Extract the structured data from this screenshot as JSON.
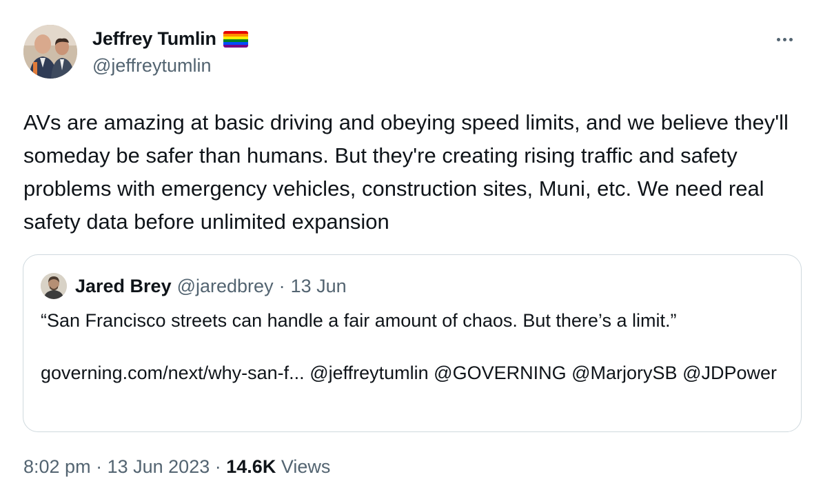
{
  "author": {
    "display_name": "Jeffrey Tumlin",
    "handle": "@jeffreytumlin",
    "badge_icon": "rainbow-flag-icon"
  },
  "tweet": {
    "text": "AVs are amazing at basic driving and obeying speed limits, and we believe they'll someday be safer than humans. But they're creating rising traffic and safety problems with emergency vehicles, construction sites, Muni, etc. We need real safety data before unlimited expansion"
  },
  "quote": {
    "author_name": "Jared Brey",
    "author_handle": "@jaredbrey",
    "separator": "·",
    "date": "13 Jun",
    "text": "“San Francisco streets can handle a fair amount of chaos. But there’s a limit.”",
    "link": "governing.com/next/why-san-f...",
    "mentions": [
      "@jeffreytumlin",
      "@GOVERNING",
      "@MarjorySB",
      "@JDPower"
    ]
  },
  "meta": {
    "time": "8:02 pm",
    "separator": "·",
    "date": "13 Jun 2023",
    "views_count": "14.6K",
    "views_label": "Views"
  },
  "colors": {
    "text_primary": "#0f1419",
    "text_secondary": "#536471",
    "border": "#cfd9de",
    "background": "#ffffff"
  }
}
